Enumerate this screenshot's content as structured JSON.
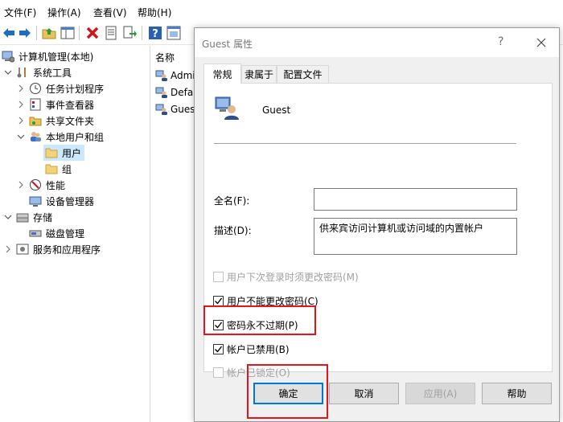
{
  "menubar": {
    "items": [
      "文件(F)",
      "操作(A)",
      "查看(V)",
      "帮助(H)"
    ]
  },
  "toolbar": {
    "icons": [
      "back-icon",
      "forward-icon",
      "up-folder-icon",
      "show-hide-tree-icon",
      "delete-icon",
      "properties-icon",
      "export-icon",
      "help-icon",
      "console-icon"
    ]
  },
  "tree": {
    "items": [
      {
        "label": "计算机管理(本地)",
        "icon": "computer-management-icon"
      },
      {
        "label": "系统工具",
        "icon": "system-tools-icon"
      },
      {
        "label": "任务计划程序",
        "icon": "task-scheduler-icon"
      },
      {
        "label": "事件查看器",
        "icon": "event-viewer-icon"
      },
      {
        "label": "共享文件夹",
        "icon": "shared-folders-icon"
      },
      {
        "label": "本地用户和组",
        "icon": "local-users-groups-icon"
      },
      {
        "label": "用户",
        "icon": "folder-icon"
      },
      {
        "label": "组",
        "icon": "folder-icon"
      },
      {
        "label": "性能",
        "icon": "performance-icon"
      },
      {
        "label": "设备管理器",
        "icon": "device-manager-icon"
      },
      {
        "label": "存储",
        "icon": "storage-icon"
      },
      {
        "label": "磁盘管理",
        "icon": "disk-management-icon"
      },
      {
        "label": "服务和应用程序",
        "icon": "services-apps-icon"
      }
    ]
  },
  "list": {
    "header": "名称",
    "items": [
      "Admi",
      "Defau",
      "Guest"
    ]
  },
  "dialog": {
    "title": "Guest 属性",
    "help_label": "?",
    "tabs": [
      "常规",
      "隶属于",
      "配置文件"
    ],
    "user_name": "Guest",
    "fullname_label": "全名(F):",
    "fullname_value": "",
    "description_label": "描述(D):",
    "description_value": "供来宾访问计算机或访问域的内置帐户",
    "checkboxes": [
      {
        "label": "用户下次登录时须更改密码(M)",
        "checked": false,
        "enabled": false
      },
      {
        "label": "用户不能更改密码(C)",
        "checked": true,
        "enabled": true
      },
      {
        "label": "密码永不过期(P)",
        "checked": true,
        "enabled": true
      },
      {
        "label": "帐户已禁用(B)",
        "checked": true,
        "enabled": true
      },
      {
        "label": "帐户已锁定(O)",
        "checked": false,
        "enabled": false
      }
    ],
    "buttons": {
      "ok": "确定",
      "cancel": "取消",
      "apply": "应用(A)",
      "help": "帮助"
    }
  },
  "colors": {
    "highlight": "#e8121c",
    "selection": "#cce8ff",
    "default_button_border": "#0078d7"
  }
}
